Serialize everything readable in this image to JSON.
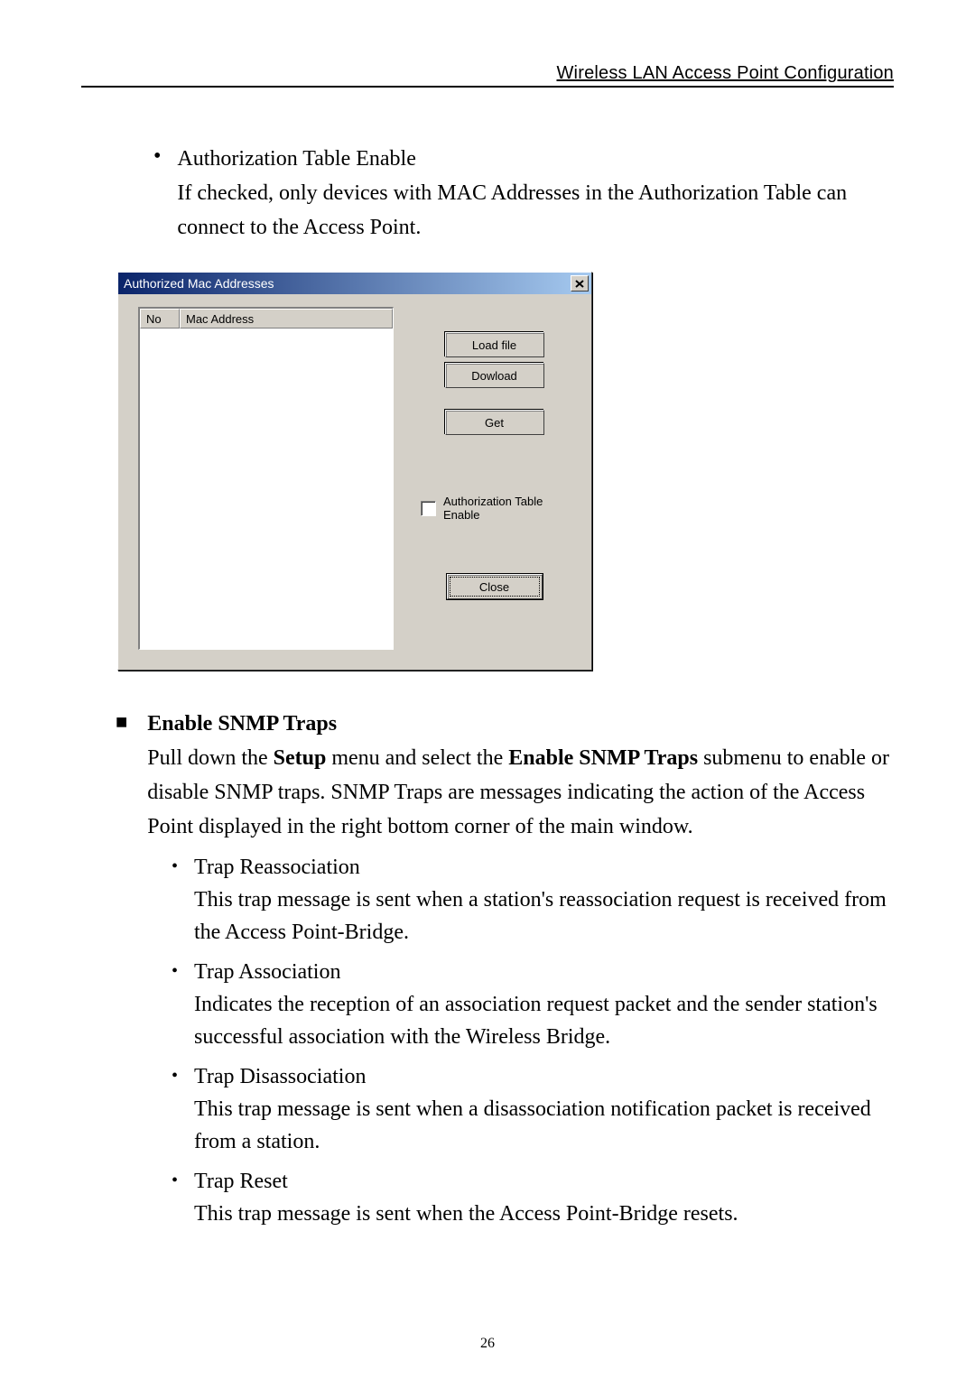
{
  "header": {
    "title": "Wireless LAN Access Point Configuration"
  },
  "auth_bullet": {
    "title": "Authorization Table Enable",
    "body": "If checked, only devices with MAC Addresses in the Authorization Table can connect to the Access Point."
  },
  "dialog": {
    "title": "Authorized Mac Addresses",
    "col_no": "No",
    "col_mac": "Mac Address",
    "btn_load": "Load file",
    "btn_download": "Dowload",
    "btn_get": "Get",
    "checkbox_label_line1": "Authorization Table",
    "checkbox_label_line2": "Enable",
    "btn_close": "Close"
  },
  "snmp_section": {
    "title": "Enable SNMP Traps",
    "body_pre": "Pull down the ",
    "body_setup": "Setup",
    "body_mid": " menu and select the ",
    "body_enable": "Enable SNMP Traps",
    "body_post": " submenu to enable or disable SNMP traps. SNMP Traps are messages indicating the action of the Access Point displayed in the right bottom corner of the main window."
  },
  "traps": [
    {
      "title": "Trap Reassociation",
      "body": "This trap message is sent when a station's reassociation request is received from the Access Point-Bridge."
    },
    {
      "title": "Trap Association",
      "body": "Indicates the reception of an association request packet and the sender station's successful association with the Wireless Bridge."
    },
    {
      "title": "Trap Disassociation",
      "body": "This trap message is sent when a disassociation notification packet is received from a station."
    },
    {
      "title": "Trap Reset",
      "body": "This trap message is sent when the Access Point-Bridge resets."
    }
  ],
  "page_number": "26"
}
